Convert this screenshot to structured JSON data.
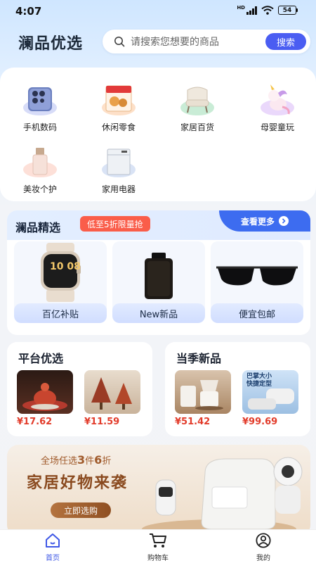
{
  "status": {
    "time": "4:07",
    "network": "HD",
    "battery": "54"
  },
  "header": {
    "brand": "澜品优选",
    "search_placeholder": "请搜索您想要的商品",
    "search_button": "搜索"
  },
  "categories": [
    {
      "label": "手机数码",
      "icon": "phone-icon"
    },
    {
      "label": "休闲零食",
      "icon": "snack-icon"
    },
    {
      "label": "家居百货",
      "icon": "chair-icon"
    },
    {
      "label": "母婴童玩",
      "icon": "unicorn-toy-icon"
    },
    {
      "label": "美妆个护",
      "icon": "cosmetic-icon"
    },
    {
      "label": "家用电器",
      "icon": "appliance-icon"
    }
  ],
  "featured": {
    "title": "澜品精选",
    "promo": "低至5折限量抢",
    "more": "查看更多",
    "tiles": [
      {
        "label": "百亿补贴",
        "product": "smartwatch",
        "watch_face": "10 08"
      },
      {
        "label": "New新品",
        "product": "perfume"
      },
      {
        "label": "便宜包邮",
        "product": "sunglasses"
      }
    ]
  },
  "sections": [
    {
      "title": "平台优选",
      "items": [
        {
          "price": "¥17.62"
        },
        {
          "price": "¥11.59"
        }
      ]
    },
    {
      "title": "当季新品",
      "items": [
        {
          "price": "¥51.42"
        },
        {
          "price": "¥99.69"
        }
      ]
    }
  ],
  "banner": {
    "sub_prefix": "全场任选",
    "sub_n1": "3",
    "sub_mid": "件",
    "sub_n2": "6",
    "sub_suffix": "折",
    "title": "家居好物来袭",
    "button": "立即选购"
  },
  "product_art": {
    "thumb_small_text_1": "巴掌大小",
    "thumb_small_text_2": "快捷定型"
  },
  "tabbar": [
    {
      "label": "首页",
      "icon": "home-icon",
      "active": true
    },
    {
      "label": "购物车",
      "icon": "cart-icon",
      "active": false
    },
    {
      "label": "我的",
      "icon": "user-icon",
      "active": false
    }
  ],
  "colors": {
    "accent": "#4a5df2",
    "promo": "#fa5d4a",
    "price": "#e23b2a",
    "tab_active": "#3e57e6"
  }
}
